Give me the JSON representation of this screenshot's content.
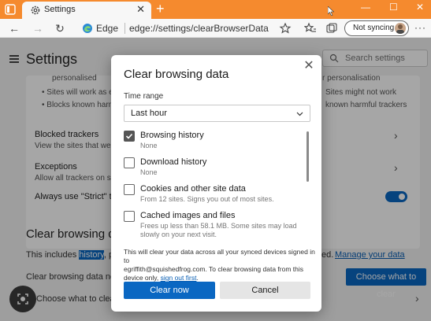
{
  "browser": {
    "tab_title": "Settings",
    "tab_close": "✕",
    "new_tab": "+",
    "window_controls": [
      "—",
      "☐",
      "✕"
    ],
    "edge_label": "Edge",
    "url": "edge://settings/clearBrowserData",
    "sync_label": "Not syncing",
    "more": "···",
    "nav": {
      "back": "←",
      "forward": "→",
      "refresh": "↻"
    },
    "accent_color": "#f58a2e"
  },
  "settings": {
    "title": "Settings",
    "search_placeholder": "Search settings",
    "bg_rows": {
      "personalised_left": "personalised",
      "personalised_right": "r personalisation",
      "sites_left": "•   Sites will work as exp",
      "sites_right": "Sites might not work",
      "blocks_left": "•   Blocks known harmful",
      "blocks_right": "known harmful trackers",
      "blocked_trackers": "Blocked trackers",
      "blocked_trackers_sub": "View the sites that we've bl",
      "exceptions": "Exceptions",
      "exceptions_sub": "Allow all trackers on sites yo",
      "always_strict": "Always use \"Strict\" trac"
    },
    "clear_section_title": "Clear browsing da",
    "includes_prefix": "This includes ",
    "includes_highlight": "history",
    "includes_suffix": ", pass",
    "includes_right": "ed.",
    "manage_link": "Manage your data",
    "clear_now_row": "Clear browsing data now",
    "choose_row": "Choose what to clear eve",
    "choose_button": "Choose what to clear"
  },
  "dialog": {
    "title": "Clear browsing data",
    "close": "✕",
    "time_range_label": "Time range",
    "time_range_value": "Last hour",
    "items": [
      {
        "label": "Browsing history",
        "sub": "None",
        "checked": true
      },
      {
        "label": "Download history",
        "sub": "None",
        "checked": false
      },
      {
        "label": "Cookies and other site data",
        "sub": "From 12 sites. Signs you out of most sites.",
        "checked": false
      },
      {
        "label": "Cached images and files",
        "sub1": "Frees up less than 58.1 MB. Some sites may load more",
        "sub2": "slowly on your next visit.",
        "checked": false
      }
    ],
    "footnote_1": "This will clear your data across all your synced devices signed in to",
    "footnote_2": "egriffith@squishedfrog.com. To clear browsing data from this",
    "footnote_3": "device only, ",
    "footnote_link": "sign out first",
    "footnote_end": ".",
    "clear_button": "Clear now",
    "cancel_button": "Cancel",
    "primary_color": "#0a67c2"
  }
}
